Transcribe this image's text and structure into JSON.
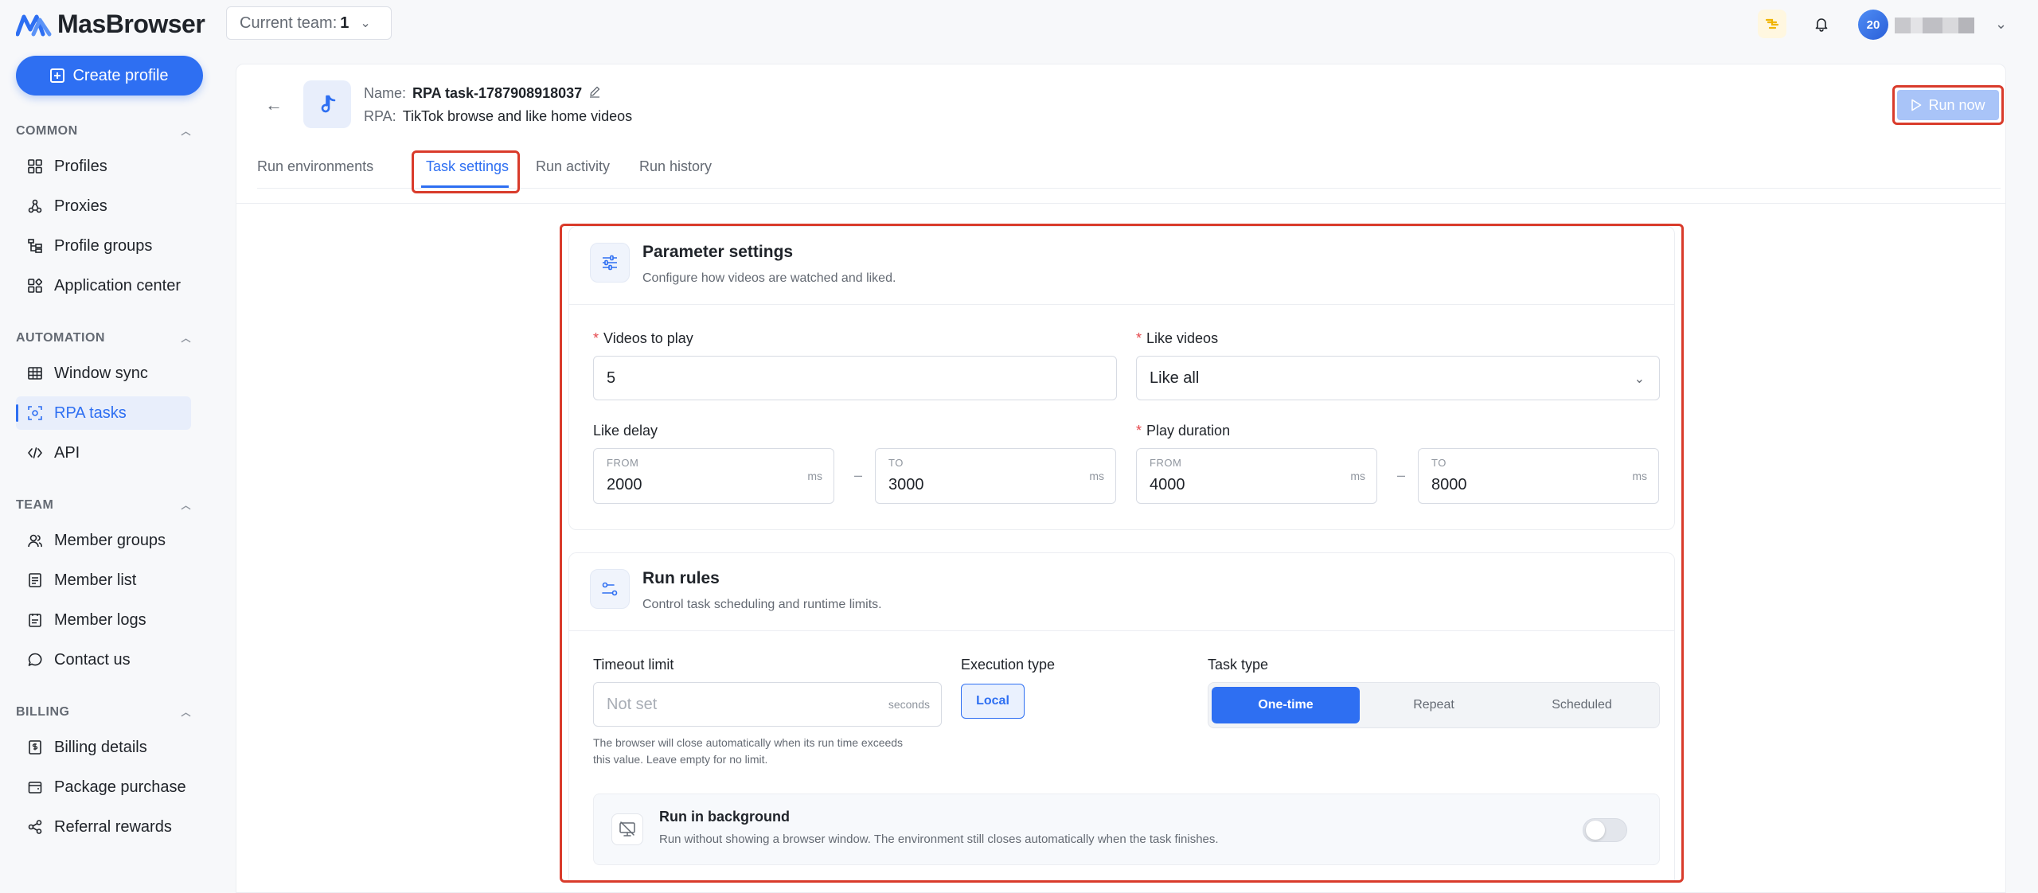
{
  "app": {
    "name": "MasBrowser"
  },
  "header": {
    "team_label": "Current team:",
    "team_value": "1",
    "avatar_text": "20"
  },
  "sidebar": {
    "create_label": "Create profile",
    "sections": [
      {
        "title": "COMMON",
        "items": [
          "Profiles",
          "Proxies",
          "Profile groups",
          "Application center"
        ]
      },
      {
        "title": "AUTOMATION",
        "items": [
          "Window sync",
          "RPA tasks",
          "API"
        ]
      },
      {
        "title": "TEAM",
        "items": [
          "Member groups",
          "Member list",
          "Member logs",
          "Contact us"
        ]
      },
      {
        "title": "BILLING",
        "items": [
          "Billing details",
          "Package purchase",
          "Referral rewards"
        ]
      }
    ],
    "active_item": "RPA tasks"
  },
  "task": {
    "name_label": "Name:",
    "name_value": "RPA task-1787908918037",
    "rpa_label": "RPA:",
    "rpa_value": "TikTok browse and like home videos",
    "run_now": "Run now"
  },
  "tabs": [
    "Run environments",
    "Task settings",
    "Run activity",
    "Run history"
  ],
  "active_tab": "Task settings",
  "params": {
    "title": "Parameter settings",
    "subtitle": "Configure how videos are watched and liked.",
    "videos_label": "Videos to play",
    "videos_value": "5",
    "like_label": "Like videos",
    "like_value": "Like all",
    "like_delay_label": "Like delay",
    "play_duration_label": "Play duration",
    "from_cap": "FROM",
    "to_cap": "TO",
    "unit_ms": "ms",
    "range_sep": "–",
    "like_delay_from": "2000",
    "like_delay_to": "3000",
    "play_from": "4000",
    "play_to": "8000"
  },
  "rules": {
    "title": "Run rules",
    "subtitle": "Control task scheduling and runtime limits.",
    "timeout_label": "Timeout limit",
    "timeout_placeholder": "Not set",
    "timeout_unit": "seconds",
    "timeout_hint_1": "The browser will close automatically when its run time exceeds",
    "timeout_hint_2": "this value. Leave empty for no limit.",
    "exec_label": "Execution type",
    "exec_value": "Local",
    "type_label": "Task type",
    "type_options": [
      "One-time",
      "Repeat",
      "Scheduled"
    ],
    "type_selected": "One-time",
    "bg_title": "Run in background",
    "bg_sub": "Run without showing a browser window. The environment still closes automatically when the task finishes.",
    "bg_enabled": false
  },
  "colors": {
    "primary": "#2e6ff2",
    "highlight": "#d93b2b",
    "required": "#e5484d"
  }
}
